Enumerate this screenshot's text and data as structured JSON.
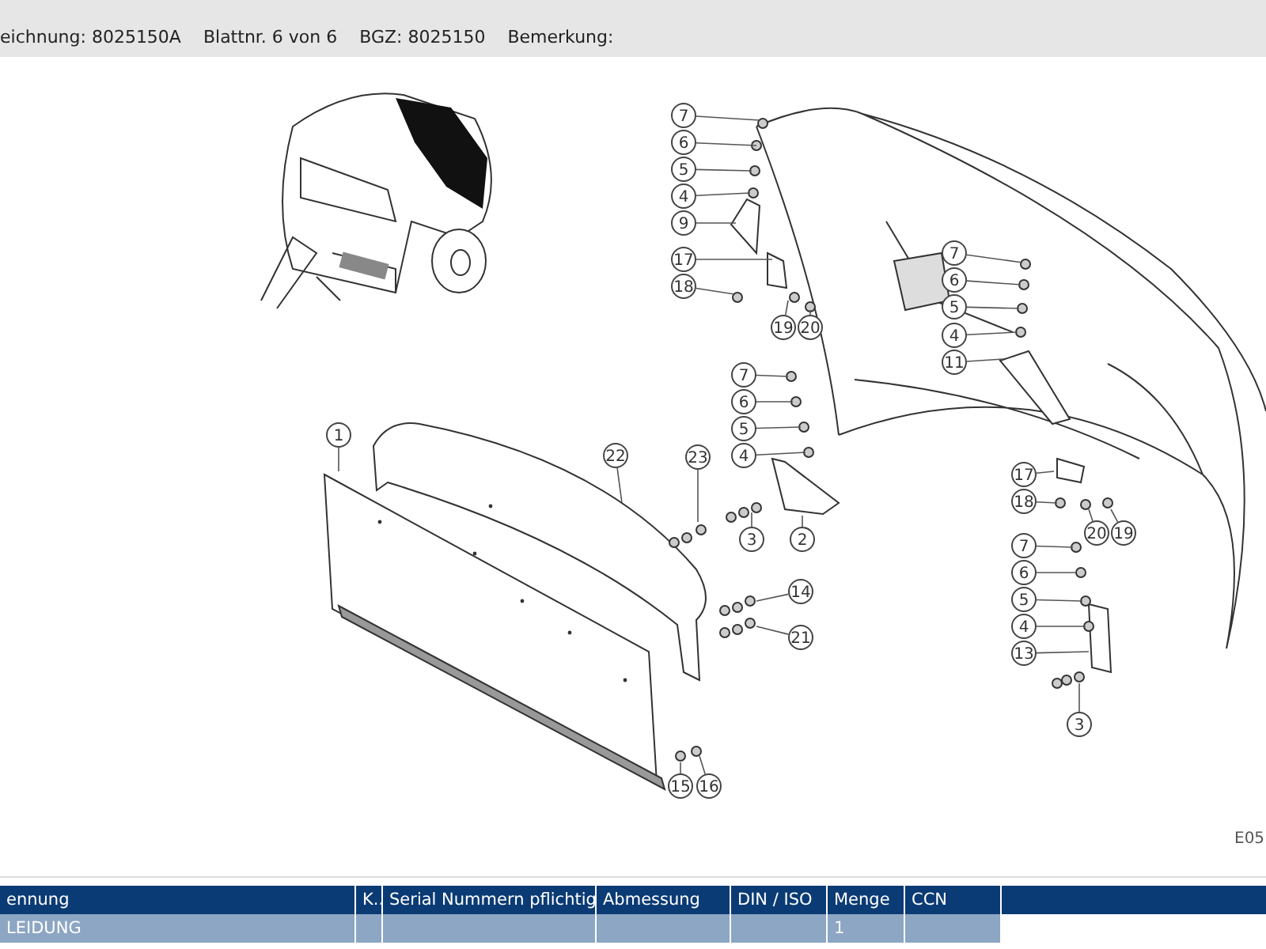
{
  "header": {
    "fields": [
      "eichnung: 8025150A",
      "Blattnr. 6 von 6",
      "BGZ: 8025150",
      "Bemerkung:"
    ]
  },
  "diagram": {
    "callouts": [
      {
        "label": "7"
      },
      {
        "label": "6"
      },
      {
        "label": "5"
      },
      {
        "label": "4"
      },
      {
        "label": "9"
      },
      {
        "label": "17"
      },
      {
        "label": "18"
      },
      {
        "label": "19"
      },
      {
        "label": "20"
      },
      {
        "label": "7"
      },
      {
        "label": "6"
      },
      {
        "label": "5"
      },
      {
        "label": "4"
      },
      {
        "label": "11"
      },
      {
        "label": "7"
      },
      {
        "label": "6"
      },
      {
        "label": "5"
      },
      {
        "label": "4"
      },
      {
        "label": "1"
      },
      {
        "label": "22"
      },
      {
        "label": "23"
      },
      {
        "label": "3"
      },
      {
        "label": "2"
      },
      {
        "label": "14"
      },
      {
        "label": "21"
      },
      {
        "label": "15"
      },
      {
        "label": "16"
      },
      {
        "label": "17"
      },
      {
        "label": "18"
      },
      {
        "label": "20"
      },
      {
        "label": "19"
      },
      {
        "label": "7"
      },
      {
        "label": "6"
      },
      {
        "label": "5"
      },
      {
        "label": "4"
      },
      {
        "label": "13"
      },
      {
        "label": "3"
      }
    ],
    "code": "E05"
  },
  "table": {
    "columns": [
      "ennung",
      "K..",
      "Serial Nummern pflichtig",
      "Abmessung",
      "DIN / ISO",
      "Menge",
      "CCN"
    ],
    "rows": [
      [
        "LEIDUNG",
        "",
        "",
        "",
        "",
        "1",
        ""
      ]
    ]
  }
}
